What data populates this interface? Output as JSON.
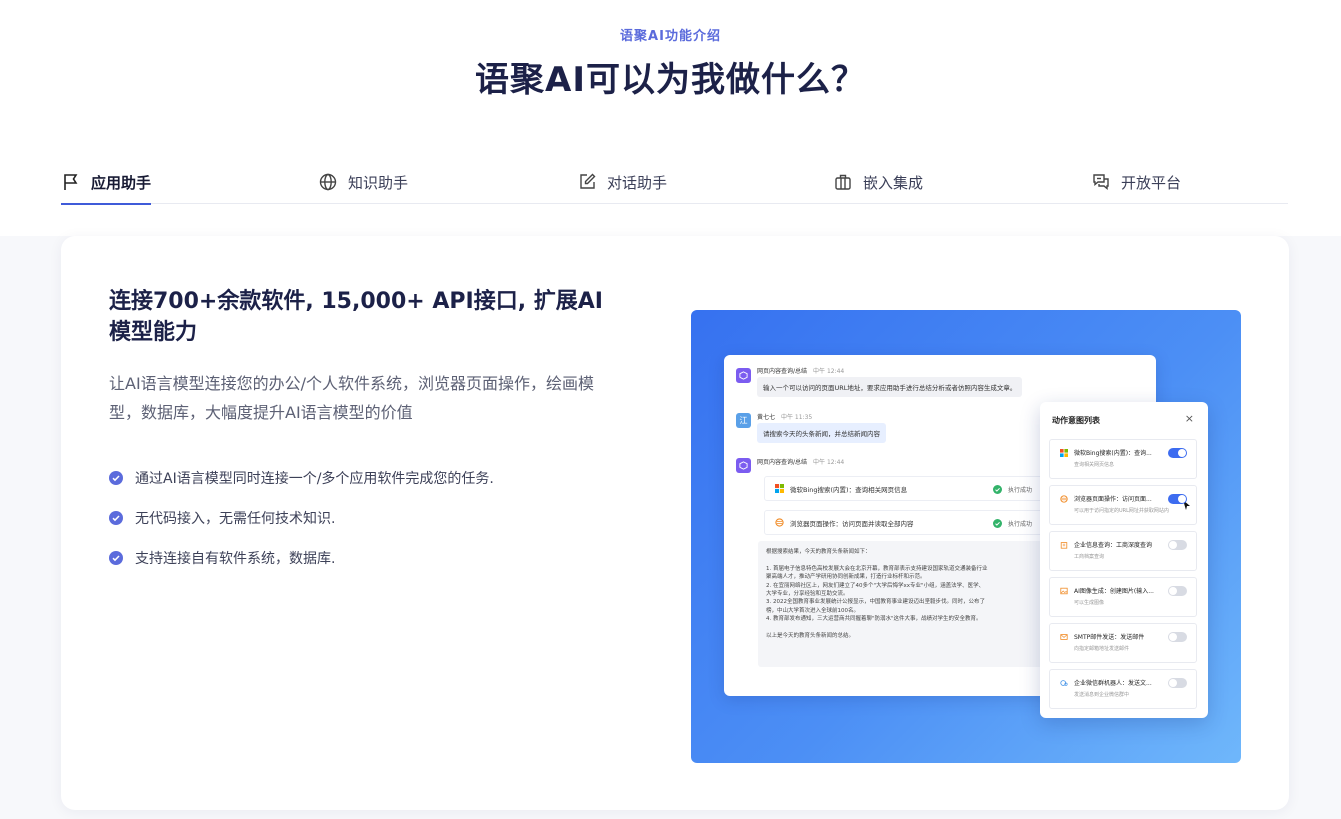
{
  "header": {
    "eyebrow": "语聚AI功能介绍",
    "title": "语聚AI可以为我做什么？"
  },
  "tabs": [
    {
      "label": "应用助手",
      "icon": "flag-icon",
      "active": true
    },
    {
      "label": "知识助手",
      "icon": "globe-icon",
      "active": false
    },
    {
      "label": "对话助手",
      "icon": "edit-icon",
      "active": false
    },
    {
      "label": "嵌入集成",
      "icon": "briefcase-icon",
      "active": false
    },
    {
      "label": "开放平台",
      "icon": "chat-bubbles-icon",
      "active": false
    }
  ],
  "content": {
    "headline": "连接700+余款软件, 15,000+ API接口, 扩展AI模型能力",
    "subtext": "让AI语言模型连接您的办公/个人软件系统，浏览器页面操作，绘画模型，数据库，大幅度提升AI语言模型的价值",
    "features": [
      "通过AI语言模型同时连接一个/多个应用软件完成您的任务.",
      "无代码接入，无需任何技术知识.",
      "支持连接自有软件系统，数据库."
    ]
  },
  "demo": {
    "msg1_name": "网页内容查询/总结",
    "msg1_time": "中午 12:44",
    "msg1_text": "输入一个可以访问的页面URL地址，要求应用助手进行总结分析或者仿照内容生成文章。",
    "msg2_avatar": "江",
    "msg2_name": "黄七七",
    "msg2_time": "中午 11:35",
    "msg2_text": "请搜索今天的头条新闻，并总结新闻内容",
    "msg3_name": "网页内容查询/总结",
    "msg3_time": "中午 12:44",
    "tool1": "微软Bing搜索(内置)：查询相关网页信息",
    "tool2": "浏览器页面操作：访问页面并读取全部内容",
    "tool_status": "执行成功",
    "answer_lines": [
      "根据搜索结果，今天的教育头条新闻如下：",
      "",
      "1. 首届电子信息特色高校发展大会在北京开幕，教育部表示支持建设国家轨道交通装备行业",
      "聚高端人才，推动产学研用协同创新成果，打造行业标杆和示范。",
      "2. 在宜丽网络社区上，网友们建立了40多个\"大学后悔学xx专业\"小组，涵盖法学、医学、",
      "大学专业，分享经验和互助交流。",
      "3. 2022全国教育事业发展统计公报显示，中国教育事业建设迈出坚毅步伐。同时，公布了",
      "榜，中山大学首次进入全球前100名。",
      "4. 教育部发布通知，三大运营商共同握着聊\"防溺水\"这件大事，战绩对学生的安全教育。",
      "",
      "以上是今天的教育头条新闻的总结。"
    ],
    "panel_title": "动作意图列表",
    "panel_close": "×",
    "actions": [
      {
        "title": "微软Bing搜索(内置)：查询...",
        "desc": "查询相关网页信息",
        "icon": "microsoft-icon",
        "on": true
      },
      {
        "title": "浏览器页面操作：访问页面...",
        "desc": "可以用于访问指定的URL网址并获取网站内",
        "icon": "browser-icon",
        "on": true
      },
      {
        "title": "企业信息查询：工商深度查询",
        "desc": "工商档案查询",
        "icon": "building-icon",
        "on": false
      },
      {
        "title": "AI图像生成：创建图片(输入...",
        "desc": "可以生成图像",
        "icon": "image-icon",
        "on": false
      },
      {
        "title": "SMTP邮件发送：发送邮件",
        "desc": "向指定邮箱地址发送邮件",
        "icon": "mail-icon",
        "on": false
      },
      {
        "title": "企业微信群机器人：发送文...",
        "desc": "发送消息到企业微信群中",
        "icon": "wecom-icon",
        "on": false
      }
    ]
  },
  "colors": {
    "accent": "#3f5bd9",
    "title": "#1c2148",
    "check": "#5b6bdc"
  }
}
